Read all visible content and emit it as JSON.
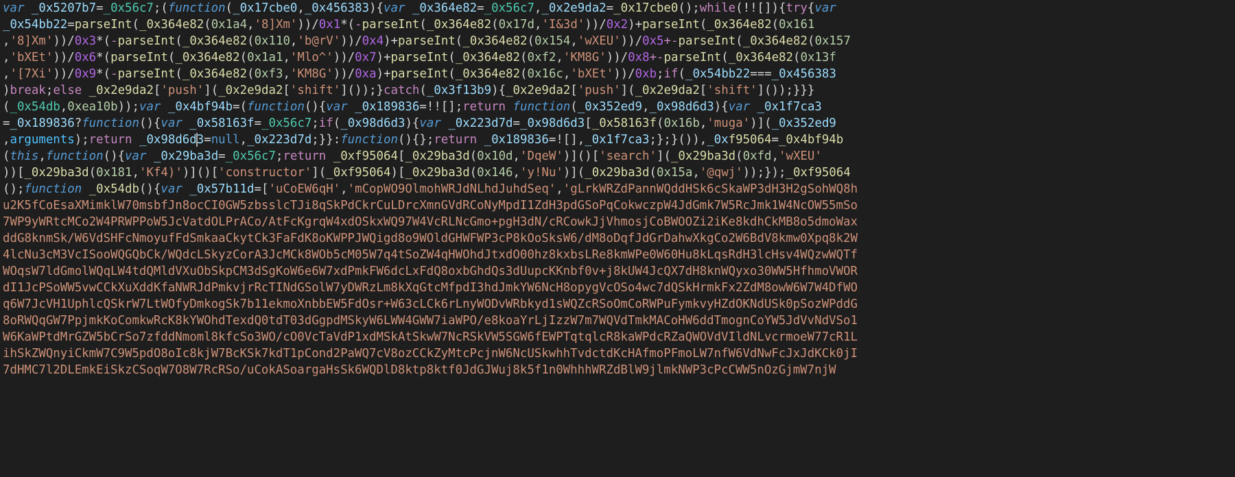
{
  "editor": {
    "language": "javascript-obfuscated",
    "theme": "dark-plus",
    "cursor": {
      "line": 11,
      "column": 31
    }
  },
  "code": {
    "l1": {
      "a": "var ",
      "b": "_0x5207b7",
      "c": "=",
      "d": "_0x56c7",
      "e": ";(",
      "f": "function",
      "g": "(",
      "h": "_0x17cbe0",
      "i": ",",
      "j": "_0x456383",
      "k": "){",
      "l": "var ",
      "m": "_0x364e82",
      "n": "=",
      "o": "_0x56c7",
      "p": ",",
      "q": "_0x2e9da2",
      "r": "=",
      "s": "_0x17cbe0",
      "t": "();",
      "u": "while",
      "v": "(!![]){",
      "w": "try",
      "x": "{",
      "y": "var "
    },
    "l2": {
      "a": "_0x54bb22",
      "b": "=",
      "c": "parseInt",
      "d": "(",
      "e": "_0x364e82",
      "f": "(",
      "g": "0x1a4",
      "h": ",",
      "i": "'8]Xm'",
      "j": "))/",
      "k": "0x1",
      "l": "*(",
      "m": "-",
      "n": "parseInt",
      "o": "(",
      "p": "_0x364e82",
      "q": "(",
      "r": "0x17d",
      "s": ",",
      "t": "'I&3d'",
      "u": "))/",
      "v": "0x2",
      "w": ")+",
      "x": "parseInt",
      "y": "(",
      "z": "_0x364e82",
      "aa": "(",
      "ab": "0x161"
    },
    "l3": {
      "a": ",",
      "b": "'8]Xm'",
      "c": "))/",
      "d": "0x3",
      "e": "*(",
      "f": "-",
      "g": "parseInt",
      "h": "(",
      "i": "_0x364e82",
      "j": "(",
      "k": "0x110",
      "l": ",",
      "m": "'b@rV'",
      "n": "))/",
      "o": "0x4",
      "p": ")+",
      "q": "parseInt",
      "r": "(",
      "s": "_0x364e82",
      "t": "(",
      "u": "0x154",
      "v": ",",
      "w": "'wXEU'",
      "x": "))/",
      "y": "0x5",
      "z": "+-",
      "aa": "parseInt",
      "ab": "(",
      "ac": "_0x364e82",
      "ad": "(",
      "ae": "0x157"
    },
    "l4": {
      "a": ",",
      "b": "'bXEt'",
      "c": "))/",
      "d": "0x6",
      "e": "*(",
      "f": "parseInt",
      "g": "(",
      "h": "_0x364e82",
      "i": "(",
      "j": "0x1a1",
      "k": ",",
      "l": "'Mlo^'",
      "m": "))/",
      "n": "0x7",
      "o": ")+",
      "p": "parseInt",
      "q": "(",
      "r": "_0x364e82",
      "s": "(",
      "t": "0xf2",
      "u": ",",
      "v": "'KM8G'",
      "w": "))/",
      "x": "0x8",
      "y": "+-",
      "z": "parseInt",
      "aa": "(",
      "ab": "_0x364e82",
      "ac": "(",
      "ad": "0x13f"
    },
    "l5": {
      "a": ",",
      "b": "'[7Xi'",
      "c": "))/",
      "d": "0x9",
      "e": "*(",
      "f": "-",
      "g": "parseInt",
      "h": "(",
      "i": "_0x364e82",
      "j": "(",
      "k": "0xf3",
      "l": ",",
      "m": "'KM8G'",
      "n": "))/",
      "o": "0xa",
      "p": ")+",
      "q": "parseInt",
      "r": "(",
      "s": "_0x364e82",
      "t": "(",
      "u": "0x16c",
      "v": ",",
      "w": "'bXEt'",
      "x": "))/",
      "y": "0xb",
      "z": ";",
      "aa": "if",
      "ab": "(",
      "ac": "_0x54bb22",
      "ad": "===",
      "ae": "_0x456383"
    },
    "l6": {
      "a": ")",
      "b": "break",
      "c": ";",
      "d": "else ",
      "e": "_0x2e9da2",
      "f": "[",
      "g": "'push'",
      "h": "](",
      "i": "_0x2e9da2",
      "j": "[",
      "k": "'shift'",
      "l": "]());}",
      "m": "catch",
      "n": "(",
      "o": "_0x3f13b9",
      "p": "){",
      "q": "_0x2e9da2",
      "r": "[",
      "s": "'push'",
      "t": "](",
      "u": "_0x2e9da2",
      "v": "[",
      "w": "'shift'",
      "x": "]());}}}"
    },
    "l7": {
      "a": "(",
      "b": "_0x54db",
      "c": ",",
      "d": "0xea10b",
      "e": "));",
      "f": "var ",
      "g": "_0x4bf94b",
      "h": "=(",
      "i": "function",
      "j": "(){",
      "k": "var ",
      "l": "_0x189836",
      "m": "=!![];",
      "n": "return ",
      "o": "function",
      "p": "(",
      "q": "_0x352ed9",
      "r": ",",
      "s": "_0x98d6d3",
      "t": "){",
      "u": "var ",
      "v": "_0x1f7ca3"
    },
    "l8": {
      "a": "=",
      "b": "_0x189836",
      "c": "?",
      "d": "function",
      "e": "(){",
      "f": "var ",
      "g": "_0x58163f",
      "h": "=",
      "i": "_0x56c7",
      "j": ";",
      "k": "if",
      "l": "(",
      "m": "_0x98d6d3",
      "n": "){",
      "o": "var ",
      "p": "_0x223d7d",
      "q": "=",
      "r": "_0x98d6d3",
      "s": "[",
      "t": "_0x58163f",
      "u": "(",
      "v": "0x16b",
      "w": ",",
      "x": "'muga'",
      "y": ")](",
      "z": "_0x352ed9"
    },
    "l9": {
      "a": ",",
      "b": "arguments",
      "c": ");",
      "d": "return ",
      "e": "_0x98d6d3",
      "f": "=",
      "g": "null",
      "h": ",",
      "i": "_0x223d7d",
      "j": ";}}:",
      "k": "function",
      "l": "(){};",
      "m": "return ",
      "n": "_0x189836",
      "o": "=![],",
      "p": "_0x1f7ca3",
      "q": ";};}()),",
      "r": "_0x",
      "r2": "f95064",
      "s": "=",
      "t": "_0x4bf94b"
    },
    "l10": {
      "a": "(",
      "b": "this",
      "c": ",",
      "d": "function",
      "e": "(){",
      "f": "var ",
      "g": "_0x29ba3d",
      "h": "=",
      "i": "_0x56c7",
      "j": ";",
      "k": "return ",
      "l": "_0xf95064",
      "m": "[",
      "n": "_0x29ba3d",
      "o": "(",
      "p": "0x10d",
      "q": ",",
      "r": "'DqeW'",
      "s": ")]()[",
      "t": "'search'",
      "u": "](",
      "v": "_0x29ba3d",
      "w": "(",
      "x": "0xfd",
      "y": ",",
      "z": "'wXEU'"
    },
    "l11": {
      "a": "))[",
      "b": "_0x29ba3d",
      "c": "(",
      "d": "0x181",
      "e": ",",
      "f": "'Kf4)'",
      "g": ")]()[",
      "h": "'constructor'",
      "i": "](",
      "j": "_0xf95064",
      "k": ")[",
      "l": "_0x29ba3d",
      "m": "(",
      "n": "0x146",
      "o": ",",
      "p": "'y!Nu'",
      "q": ")](",
      "r": "_0x29ba3d",
      "s": "(",
      "t": "0x15a",
      "u": ",",
      "v": "'@qwj'",
      "w": "));});",
      "x": "_0xf95064"
    },
    "l12": {
      "a": "();",
      "b": "function ",
      "c": "_0x54db",
      "d": "(){",
      "e": "var ",
      "f": "_0x57b11d",
      "g": "=[",
      "h": "'uCoEW6qH'",
      "i": ",",
      "j": "'mCopWO9OlmohWRJdNLhdJuhdSeq'",
      "k": ",",
      "l": "'gLrkWRZdPannWQddHSk6cSkaWP3dH3H2gSohWQ8h"
    },
    "blob": [
      "u2K5fCoEsaXMimklW70msbfJn8ocCI0GW5zbsslcTJi8qSkPdCkrCuLDrcXmnGVdRCoNyMpdI1ZdH3pdGSoPqCokwczpW4JdGmk7W5RcJmk1W4NcOW55mSo",
      "7WP9yWRtcMCo2W4PRWPPoW5JcVatdOLPrACo/AtFcKgrqW4xdOSkxWQ97W4VcRLNcGmo+pgH3dN/cRCowkJjVhmosjCoBWOOZi2iKe8kdhCkMB8o5dmoWax",
      "ddG8knmSk/W6VdSHFcNmoyufFdSmkaaCkytCk3FaFdK8oKWPPJWQigd8o9WOldGHWFWP3cP8kOoSksW6/dM8oDqfJdGrDahwXkgCo2W6BdV8kmw0Xpq8k2W",
      "4lcNu3cM3VcISooWQGQbCk/WQdcLSkyzCorA3JcMCk8WOb5cM05W7q4tSoZW4qHWOhdJtxdO00hz8kxbsLRe8kmWPe0W60Hu8kLqsRdH3lcHsv4WQzwWQTf",
      "WOqsW7ldGmolWQqLW4tdQMldVXuObSkpCM3dSgKoW6e6W7xdPmkFW6dcLxFdQ8oxbGhdQs3dUupcKKnbf0v+j8kUW4JcQX7dH8knWQyxo30WW5HfhmoVWOR",
      "dI1JcPSoWW5vwCCkXuXddKfaNWRJdPmkvjrRcTINdGSolW7yDWRzLm8kXqGtcMfpdI3hdJmkYW6NcH8opygVcOSo4wc7dQSkHrmkFx2ZdM8owW6W7W4DfWO",
      "q6W7JcVH1UphlcQSkrW7LtWOfyDmkogSk7b11ekmoXnbbEW5FdOsr+W63cLCk6rLnyWODvWRbkyd1sWQZcRSoOmCoRWPuFymkvyHZdOKNdUSk0pSozWPddG",
      "8oRWQqGW7PpjmkKoComkwRcK8kYWOhdTexdQ0tdT03dGgpdMSkyW6LWW4GWW7iaWPO/e8koaYrLjIzzW7m7WQVdTmkMACoHW6ddTmognCoYW5JdVvNdVSo1",
      "W6KaWPtdMrGZW5bCrSo7zfddNmoml8kfcSo3WO/cO0VcTaVdP1xdMSkAtSkwW7NcRSkVW5SGW6fEWPTqtqlcR8kaWPdcRZaQWOVdVIldNLvcrmoeW77cR1L",
      "ihSkZWQnyiCkmW7C9W5pdO8oIc8kjW7BcKSk7kdT1pCond2PaWQ7cV8ozCCkZyMtcPcjnW6NcUSkwhhTvdctdKcHAfmoPFmoLW7nfW6VdNwFcJxJdKCk0jI",
      "7dHMC7l2DLEmkEiSkzCSoqW7O8W7RcRSo/uCokASoargaHsSk6WQDlD8ktp8ktf0JdGJWuj8k5f1n0WhhhWRZdBlW9jlmkNWP3cPcCWW5nOzGjmW7njW"
    ]
  }
}
